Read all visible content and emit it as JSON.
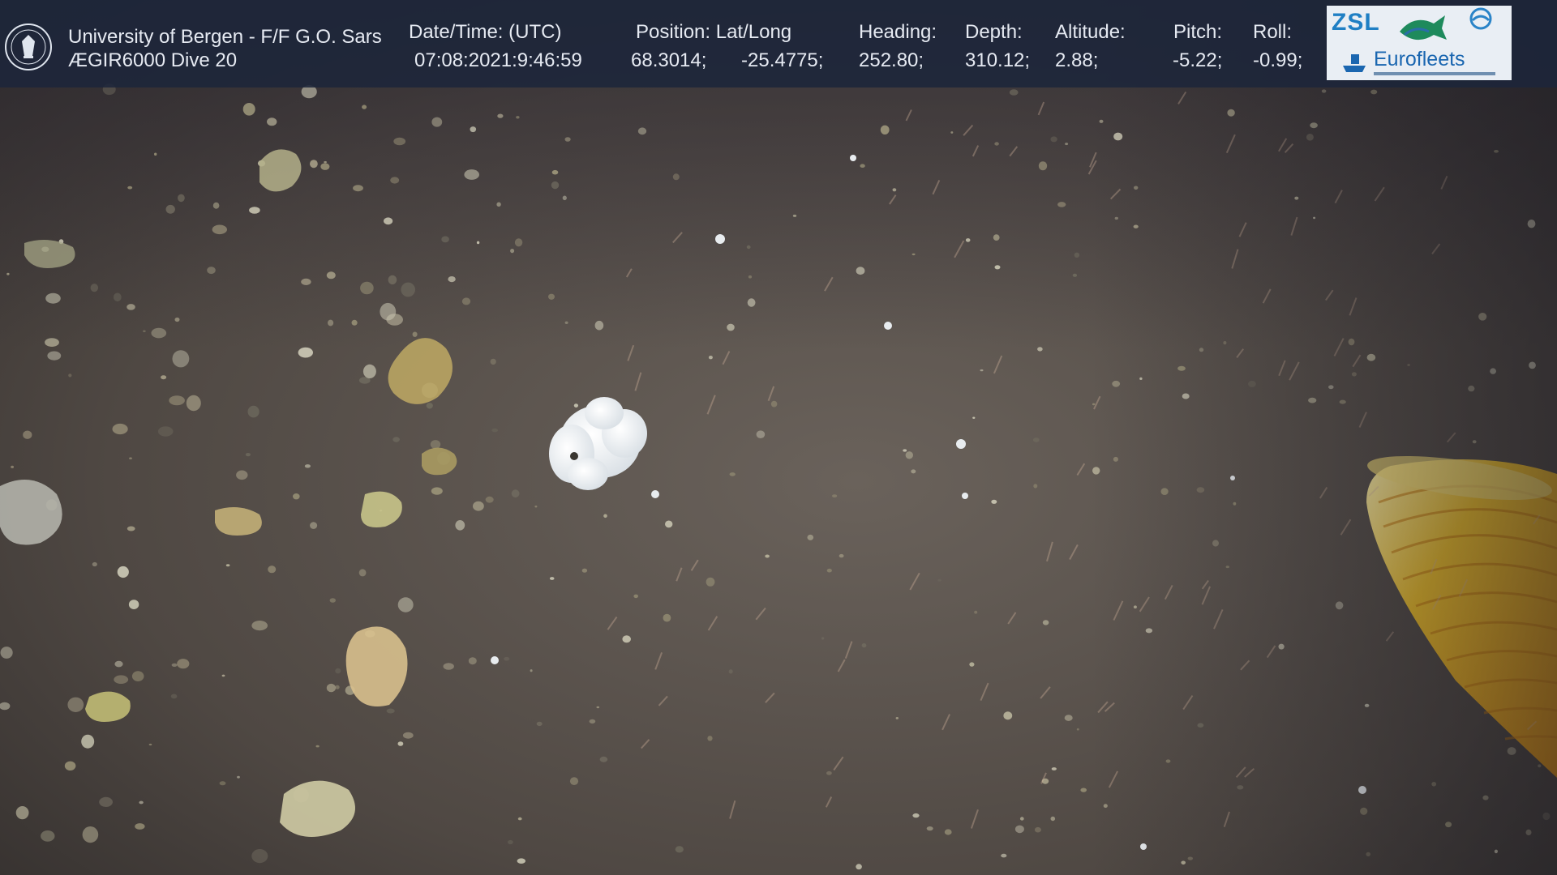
{
  "header": {
    "institution": "University of Bergen - F/F G.O. Sars",
    "dive": "ÆGIR6000 Dive 20",
    "datetime_label": "Date/Time: (UTC)",
    "datetime_value": "07:08:2021:9:46:59",
    "position_label": "Position: Lat/Long",
    "lat_value": "68.3014;",
    "long_value": "-25.4775;",
    "heading_label": "Heading:",
    "heading_value": "252.80;",
    "depth_label": "Depth:",
    "depth_value": "310.12;",
    "altitude_label": "Altitude:",
    "altitude_value": "2.88;",
    "pitch_label": "Pitch:",
    "pitch_value": "-5.22;",
    "roll_label": "Roll:",
    "roll_value": "-0.99;"
  },
  "logos": {
    "zsl": "ZSL",
    "eurofleets": "Eurofleets"
  },
  "icons": {
    "uib_seal": "university-seal-icon",
    "fish": "fish-logo-icon",
    "wave": "wave-logo-icon",
    "ship": "ship-logo-icon"
  },
  "colors": {
    "overlay_bar": "#1c263a",
    "seafloor": "#4a4440",
    "sampler_hose": "#f2b51c"
  }
}
